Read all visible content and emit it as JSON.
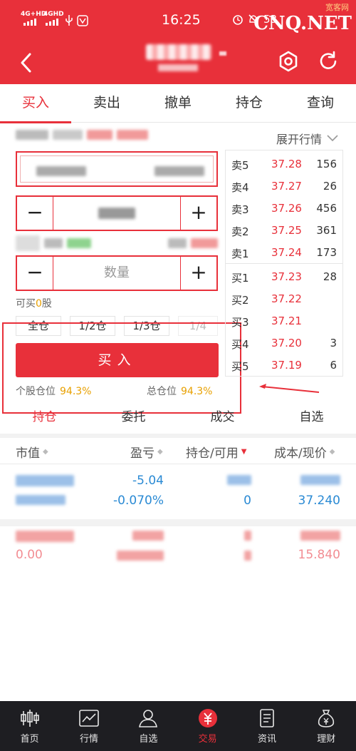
{
  "status_bar": {
    "net1": "4G+HD",
    "net2": "4GHD",
    "time": "16:25",
    "battery": "53"
  },
  "watermark": {
    "text": "CNQ.NET",
    "sub": "宽客网"
  },
  "header": {
    "stock_name": "",
    "stock_code": "",
    "accent": "#e8303a"
  },
  "tabs": [
    "买入",
    "卖出",
    "撤单",
    "持仓",
    "查询"
  ],
  "quote": {
    "price": "37.24",
    "expand_label": "展开行情"
  },
  "form": {
    "price_value": "37.24",
    "qty_placeholder": "数量",
    "minus": "−",
    "plus": "+",
    "available_prefix": "可买",
    "available_value": "0",
    "available_suffix": "股",
    "ratios": [
      "全仓",
      "1/2仓",
      "1/3仓",
      "1/4"
    ],
    "buy_button": "买入",
    "stock_pos_label": "个股仓位",
    "stock_pos_value": "94.3%",
    "total_pos_label": "总仓位",
    "total_pos_value": "94.3%"
  },
  "order_book": {
    "asks": [
      {
        "label": "卖5",
        "price": "37.28",
        "vol": "156"
      },
      {
        "label": "卖4",
        "price": "37.27",
        "vol": "26"
      },
      {
        "label": "卖3",
        "price": "37.26",
        "vol": "456"
      },
      {
        "label": "卖2",
        "price": "37.25",
        "vol": "361"
      },
      {
        "label": "卖1",
        "price": "37.24",
        "vol": "173"
      }
    ],
    "bids": [
      {
        "label": "买1",
        "price": "37.23",
        "vol": "28"
      },
      {
        "label": "买2",
        "price": "37.22",
        "vol": ""
      },
      {
        "label": "买3",
        "price": "37.21",
        "vol": ""
      },
      {
        "label": "买4",
        "price": "37.20",
        "vol": "3"
      },
      {
        "label": "买5",
        "price": "37.19",
        "vol": "6"
      }
    ]
  },
  "sub_tabs": [
    "持仓",
    "委托",
    "成交",
    "自选"
  ],
  "columns": [
    "市值",
    "盈亏",
    "持仓/可用",
    "成本/现价"
  ],
  "holdings": [
    {
      "pl": "-5.04",
      "pl_pct": "-0.070%",
      "avail": "0",
      "now": "37.240"
    },
    {
      "pl": "",
      "pl_pct": "",
      "avail": "",
      "now": "15.840",
      "extra": "0.00"
    }
  ],
  "nav": [
    "首页",
    "行情",
    "自选",
    "交易",
    "资讯",
    "理财"
  ],
  "nav_active": "交易"
}
